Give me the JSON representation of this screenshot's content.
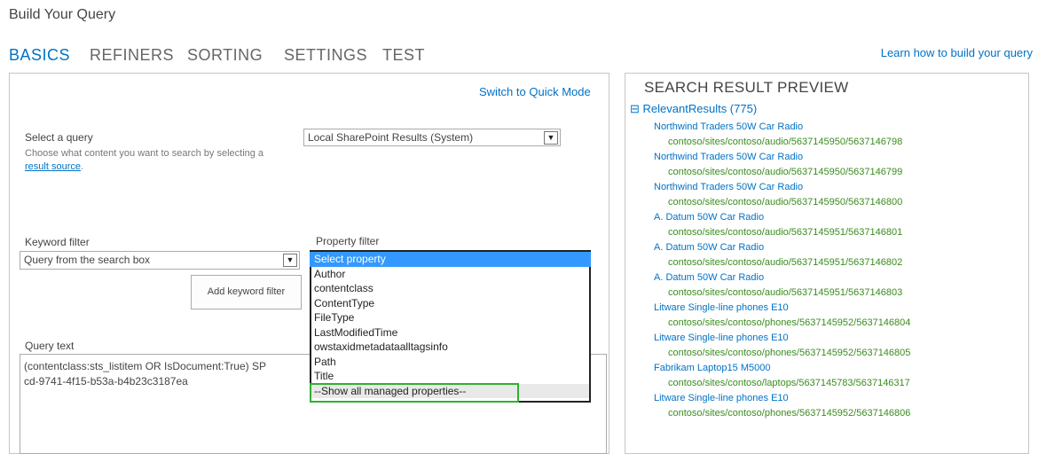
{
  "dialog_title": "Build Your Query",
  "tabs": [
    {
      "label": "BASICS",
      "active": true
    },
    {
      "label": "REFINERS",
      "active": false
    },
    {
      "label": "SORTING",
      "active": false
    },
    {
      "label": "SETTINGS",
      "active": false
    },
    {
      "label": "TEST",
      "active": false
    }
  ],
  "learn_link": "Learn how to build your query",
  "switch_mode": "Switch to Quick Mode",
  "select_query": {
    "label": "Select a query",
    "help_prefix": "Choose what content you want to search by selecting a ",
    "help_link": "result source",
    "help_suffix": ".",
    "value": "Local SharePoint Results (System)"
  },
  "keyword_filter": {
    "label": "Keyword filter",
    "value": "Query from the search box",
    "add_button": "Add keyword filter"
  },
  "property_filter": {
    "label": "Property filter",
    "options": [
      "Select property",
      "Author",
      "contentclass",
      "ContentType",
      "FileType",
      "LastModifiedTime",
      "owstaxidmetadataalltagsinfo",
      "Path",
      "Title",
      "--Show all managed properties--"
    ],
    "selected": "Select property"
  },
  "query_text": {
    "label": "Query text",
    "line1": "(contentclass:sts_listitem OR IsDocument:True) SP",
    "line2": "cd-9741-4f15-b53a-b4b23c3187ea"
  },
  "preview": {
    "title": "SEARCH RESULT PREVIEW",
    "expander": "⊟",
    "group": "RelevantResults (775)",
    "results": [
      {
        "title": "Northwind Traders 50W Car Radio",
        "url": "contoso/sites/contoso/audio/5637145950/5637146798"
      },
      {
        "title": "Northwind Traders 50W Car Radio",
        "url": "contoso/sites/contoso/audio/5637145950/5637146799"
      },
      {
        "title": "Northwind Traders 50W Car Radio",
        "url": "contoso/sites/contoso/audio/5637145950/5637146800"
      },
      {
        "title": "A. Datum 50W Car Radio",
        "url": "contoso/sites/contoso/audio/5637145951/5637146801"
      },
      {
        "title": "A. Datum 50W Car Radio",
        "url": "contoso/sites/contoso/audio/5637145951/5637146802"
      },
      {
        "title": "A. Datum 50W Car Radio",
        "url": "contoso/sites/contoso/audio/5637145951/5637146803"
      },
      {
        "title": "Litware Single-line phones E10",
        "url": "contoso/sites/contoso/phones/5637145952/5637146804"
      },
      {
        "title": "Litware Single-line phones E10",
        "url": "contoso/sites/contoso/phones/5637145952/5637146805"
      },
      {
        "title": "Fabrikam Laptop15 M5000",
        "url": "contoso/sites/contoso/laptops/5637145783/5637146317"
      },
      {
        "title": "Litware Single-line phones E10",
        "url": "contoso/sites/contoso/phones/5637145952/5637146806"
      }
    ]
  },
  "colors": {
    "accent": "#0072c6",
    "url_green": "#3a8c1f",
    "highlight": "#2db12d",
    "selected": "#3399ff"
  },
  "icons": {
    "dropdown": "chevron-down-icon",
    "collapse": "collapse-icon"
  }
}
